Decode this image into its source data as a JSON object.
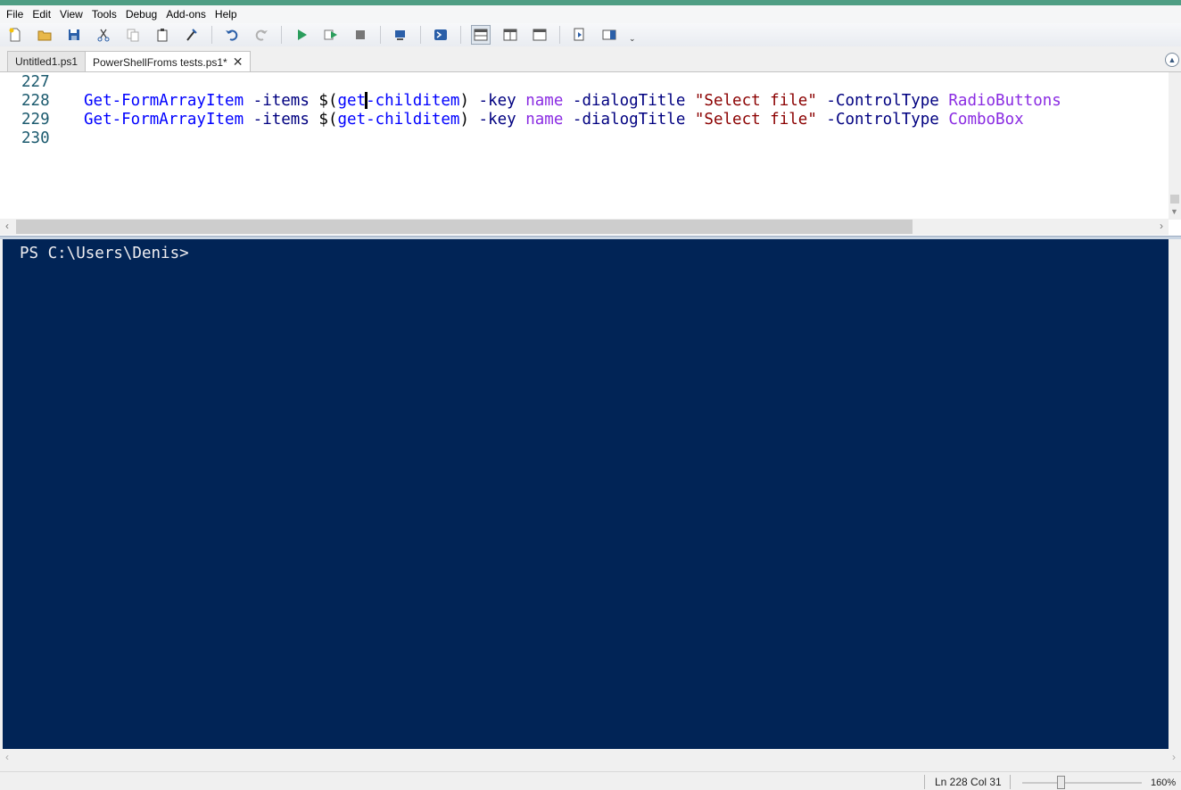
{
  "menu": [
    "File",
    "Edit",
    "View",
    "Tools",
    "Debug",
    "Add-ons",
    "Help"
  ],
  "toolbar": {
    "icons": [
      "new-file-icon",
      "open-folder-icon",
      "save-icon",
      "cut-icon",
      "copy-icon",
      "paste-icon",
      "clear-console-icon",
      "undo-icon",
      "redo-icon",
      "run-script-icon",
      "run-selection-icon",
      "stop-icon",
      "new-remote-tab-icon",
      "start-powershell-icon",
      "show-script-pane-top-icon",
      "show-script-pane-right-icon",
      "show-script-pane-maximized-icon",
      "show-command-window-icon",
      "show-command-addon-icon"
    ],
    "overflow": "⌄"
  },
  "tabs": [
    {
      "label": "Untitled1.ps1",
      "active": false
    },
    {
      "label": "PowerShellFroms tests.ps1*",
      "active": true,
      "close": "✕"
    }
  ],
  "editor": {
    "lines": [
      {
        "no": "227",
        "tokens": []
      },
      {
        "no": "228",
        "tokens": [
          {
            "t": "Get-FormArrayItem",
            "c": "cmd"
          },
          {
            "t": " -items",
            "c": "param"
          },
          {
            "t": " $(",
            "c": "plain"
          },
          {
            "t": "get",
            "c": "cmd"
          },
          {
            "t": "CARET",
            "c": "caret"
          },
          {
            "t": "-childitem",
            "c": "cmd"
          },
          {
            "t": ")",
            "c": "plain"
          },
          {
            "t": " -key",
            "c": "param"
          },
          {
            "t": " name",
            "c": "arg"
          },
          {
            "t": " -dialogTitle",
            "c": "param"
          },
          {
            "t": " \"Select file\"",
            "c": "str"
          },
          {
            "t": " -ControlType",
            "c": "param"
          },
          {
            "t": " RadioButtons",
            "c": "arg"
          }
        ]
      },
      {
        "no": "229",
        "tokens": [
          {
            "t": "Get-FormArrayItem",
            "c": "cmd"
          },
          {
            "t": " -items",
            "c": "param"
          },
          {
            "t": " $(",
            "c": "plain"
          },
          {
            "t": "get-childitem",
            "c": "cmd"
          },
          {
            "t": ")",
            "c": "plain"
          },
          {
            "t": " -key",
            "c": "param"
          },
          {
            "t": " name",
            "c": "arg"
          },
          {
            "t": " -dialogTitle",
            "c": "param"
          },
          {
            "t": " \"Select file\"",
            "c": "str"
          },
          {
            "t": " -ControlType",
            "c": "param"
          },
          {
            "t": " ComboBox",
            "c": "arg"
          }
        ]
      },
      {
        "no": "230",
        "tokens": []
      }
    ]
  },
  "console": {
    "prompt": "PS C:\\Users\\Denis>"
  },
  "status": {
    "position": "Ln 228  Col 31",
    "zoom": "160%",
    "zoom_level_fraction": 0.33
  },
  "colors": {
    "console_bg": "#012456",
    "accent_strip": "#4f9e84",
    "cmd": "#0000ff",
    "param": "#000080",
    "arg": "#8a2be2",
    "string": "#8b0000"
  }
}
